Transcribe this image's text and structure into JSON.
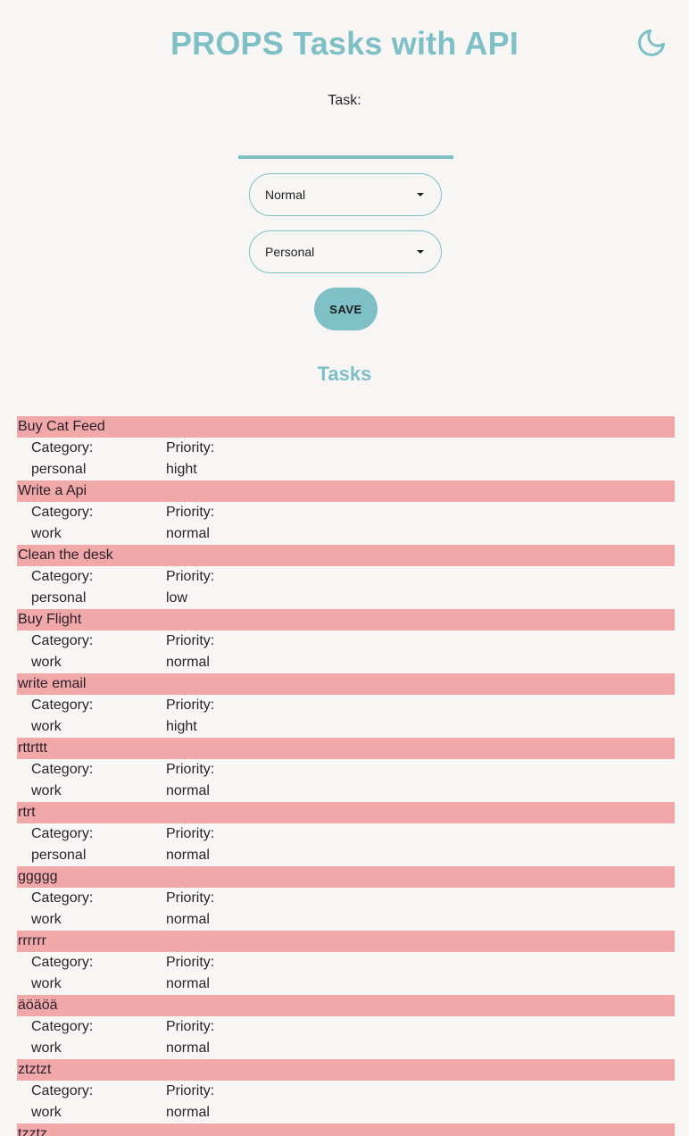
{
  "header": {
    "title": "PROPS Tasks with API",
    "theme_toggle_icon": "moon-icon"
  },
  "form": {
    "task_label": "Task:",
    "task_input_value": "",
    "priority_select_value": "Normal",
    "category_select_value": "Personal",
    "save_label": "SAVE"
  },
  "tasks_section": {
    "heading": "Tasks",
    "category_label": "Category:",
    "priority_label": "Priority:",
    "items": [
      {
        "name": "Buy Cat Feed",
        "category": "personal",
        "priority": "hight"
      },
      {
        "name": "Write a Api",
        "category": "work",
        "priority": "normal"
      },
      {
        "name": "Clean the desk",
        "category": "personal",
        "priority": "low"
      },
      {
        "name": "Buy Flight",
        "category": "work",
        "priority": "normal"
      },
      {
        "name": "write email",
        "category": "work",
        "priority": "hight"
      },
      {
        "name": "rttrttt",
        "category": "work",
        "priority": "normal"
      },
      {
        "name": "rtrt",
        "category": "personal",
        "priority": "normal"
      },
      {
        "name": "ggggg",
        "category": "work",
        "priority": "normal"
      },
      {
        "name": "rrrrrr",
        "category": "work",
        "priority": "normal"
      },
      {
        "name": "äöäöä",
        "category": "work",
        "priority": "normal"
      },
      {
        "name": "ztztzt",
        "category": "work",
        "priority": "normal"
      },
      {
        "name": "tzztz",
        "category": "",
        "priority": ""
      }
    ]
  },
  "colors": {
    "accent": "#7fbfc6",
    "task_bar": "#f0a8a8",
    "background": "#f8f6f5"
  }
}
